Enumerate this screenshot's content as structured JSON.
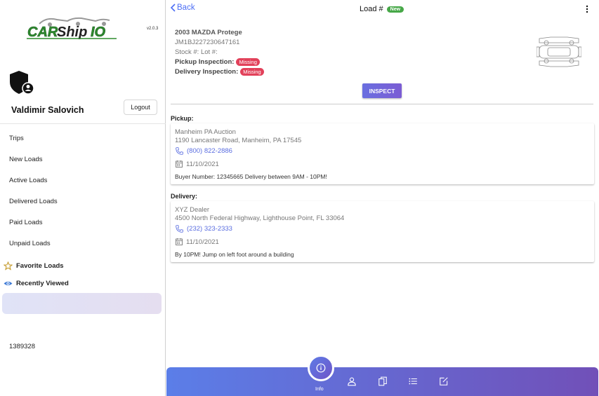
{
  "app": {
    "logo_text": "CARShipIO",
    "version": "v2.0.3"
  },
  "user": {
    "name": "Valdimir Salovich",
    "logout_label": "Logout"
  },
  "sidebar": {
    "items": [
      {
        "label": "Trips"
      },
      {
        "label": "New Loads"
      },
      {
        "label": "Active Loads"
      },
      {
        "label": "Delivered Loads"
      },
      {
        "label": "Paid Loads"
      },
      {
        "label": "Unpaid Loads"
      }
    ],
    "favorite_label": "Favorite Loads",
    "recent_label": "Recently Viewed",
    "code": "1389328"
  },
  "header": {
    "back_label": "Back",
    "title": "Load #",
    "badge": "New"
  },
  "vehicle": {
    "name": "2003 MAZDA Protege",
    "vin": "JM1BJ227230647161",
    "stock_lot": "Stock #:  Lot #:",
    "pickup_inspection_label": "Pickup Inspection:",
    "delivery_inspection_label": "Delivery Inspection:",
    "pickup_status": "Missing",
    "delivery_status": "Missing",
    "inspect_label": "INSPECT"
  },
  "pickup": {
    "section_label": "Pickup:",
    "name": "Manheim PA Auction",
    "address": "1190 Lancaster Road, Manheim, PA 17545",
    "phone": "(800) 822-2886",
    "date": "11/10/2021",
    "note": "Buyer Number: 12345665 Delivery between 9AM - 10PM!"
  },
  "delivery": {
    "section_label": "Delivery:",
    "name": "XYZ Dealer",
    "address": "4500 North Federal Highway, Lighthouse Point, FL 33064",
    "phone": "(232) 323-2333",
    "date": "11/10/2021",
    "note": "By 10PM! Jump on left foot around a building"
  },
  "bottom_nav": {
    "info_label": "Info",
    "icons": [
      "info-icon",
      "person-icon",
      "documents-icon",
      "list-icon",
      "edit-icon"
    ]
  },
  "colors": {
    "accent": "#4c6ef5",
    "badge_new": "#47a848",
    "badge_missing": "#e2415a",
    "bar_start": "#5b7ee8",
    "bar_end": "#7150b8"
  }
}
